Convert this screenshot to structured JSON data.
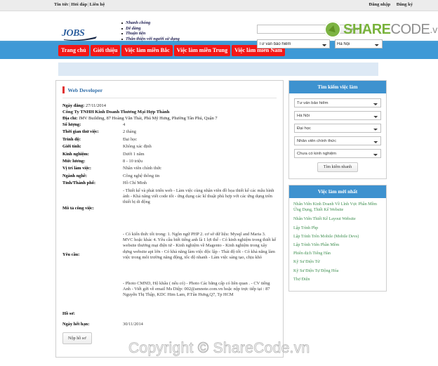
{
  "topbar": {
    "links": [
      "Tin tức",
      "Hỏi đáp",
      "Liên hệ"
    ],
    "login": "Đăng nhập",
    "register": "Đăng ký"
  },
  "header": {
    "logo_text": "JOBS",
    "taglines": [
      "Nhanh chóng",
      "Dễ dàng",
      "Thuận tiện",
      "Thân thiện với người sử dụng"
    ],
    "search_value": "",
    "search_placeholder": "",
    "search_button": "Tìm kiếm",
    "category_selected": "Tư vấn bảo hiểm",
    "location_selected": "Hà Nội",
    "watermark": {
      "word1": "SHARE",
      "word2": "CODE",
      "word3": ".vn"
    }
  },
  "nav": {
    "items": [
      "Trang chủ",
      "Giới thiệu",
      "Việc làm miền Bắc",
      "Việc làm miền Trung",
      "Việc làm miền Nam"
    ]
  },
  "job": {
    "title": "Web Developer",
    "posted_label": "Ngày đăng:",
    "posted_value": "27/11/2014",
    "company": "Công Ty TNHH Kinh Doanh Thương Mại Hợp Thành",
    "address_label": "Địa chỉ:",
    "address_value": "IMV Building, 87 Hoàng Văn Thái, Phú Mỹ Hưng, Phường Tân Phú, Quận 7",
    "details": [
      {
        "label": "Số lượng:",
        "value": "4"
      },
      {
        "label": "Thời gian thử việc:",
        "value": "2 tháng"
      },
      {
        "label": "Trình độ:",
        "value": "Đại học"
      },
      {
        "label": "Giới tính:",
        "value": "Không xác định"
      },
      {
        "label": "Kinh nghiệm:",
        "value": "Dưới 1 năm"
      },
      {
        "label": "Mức lương:",
        "value": "8 - 10 triệu"
      },
      {
        "label": "Vị trí làm việc:",
        "value": "Nhân viên chính thức"
      },
      {
        "label": "Ngành nghề:",
        "value": "Công nghệ thông tin"
      },
      {
        "label": "Tỉnh/Thành phố:",
        "value": "Hồ Chí Minh"
      }
    ],
    "description_label": "Mô tả công việc:",
    "description_value": "- Thiết kế và phát triển web - Làm việc cùng nhân viên đồ họa thiết kế các mẫu hình ảnh - Khả năng viết code tốt - ứng dụng các kĩ thuật phù hợp với các ứng dụng trên thiết bị di động",
    "requirement_label": "Yêu cầu:",
    "requirement_value": "- Có kiến thức tốt trong: 1. Ngôn ngữ PHP 2. cơ sở dữ liệu: Mysql and Maria 3. MVC hoặc khác 4. Yêu cầu biết tiếng anh là 1 lợi thế - Có kinh nghiệm trong thiết kế website thương mại điện tử - Kinh nghiệm về Magento - Kinh nghiệm trong xây dựng website api lớn - Có khả năng làm việc độc lập - Thái độ tốt - Có khả năng làm việc trong môi trường năng động, tốc độ nhanh - Làm việc sáng tạo, chịu khó",
    "profile_label": "Hồ sơ:",
    "profile_value": "- Photo CMND, Hộ khẩu ( nếu có) - Photo Các bằng cấp có liên quan . - CV tiếng Anh - Viết gửi về email Ms Diệp: 002@amnote.com.vn hoặc nộp trực tiếp tại : 87 Nguyễn Thị Thập, KDC Him Lam, P.Tân Hưng,Q7, Tp HCM",
    "deadline_label": "Ngày hết hạn:",
    "deadline_value": "30/11/2014",
    "apply_button": "Nộp hồ sơ"
  },
  "sidebar": {
    "search_panel": {
      "title": "Tìm kiếm việc làm",
      "selects": [
        "Tư vấn bảo hiểm",
        "Hà Nội",
        "Đại học",
        "Nhân viên chính thức",
        "Chưa có kinh nghiệm"
      ],
      "button": "Tìm kiếm nhanh"
    },
    "latest_panel": {
      "title": "Việc làm mới nhất",
      "items": [
        "Nhân Viên Kinh Doanh Về Lĩnh Vực Phần Mềm Ứng Dụng, Thiết Kế Website",
        "Nhân Viên Thiết Kế Layout Website",
        "Lập Trình Php",
        "Lập Trình Trên Mobile (Mobile Devs)",
        "Lập Trình Viên Phần Mềm",
        "Phiên dịch Tiếng Hàn",
        "Kỹ Sư Điện Tử",
        "Kỹ Sư Điện Tự Động Hóa",
        "Thợ Điện"
      ]
    }
  },
  "watermark": {
    "footer": "Copyright © ShareCode.vn"
  },
  "colors": {
    "nav_bg": "#3e99d6",
    "nav_item_bg": "#f31717",
    "panel_head_bg": "#3e92cf",
    "link_green": "#3f8f50",
    "title_blue": "#2f6da8",
    "banner_blue": "#dde9f5"
  }
}
